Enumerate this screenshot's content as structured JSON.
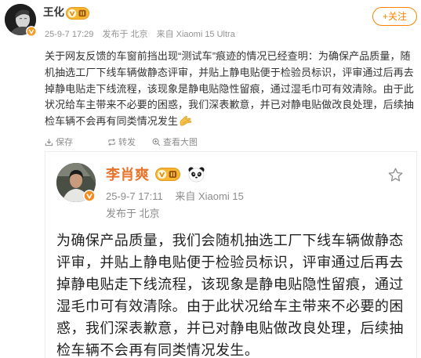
{
  "post": {
    "author": {
      "name": "王化",
      "verified_icon": "verified-badge-icon",
      "vip_icon": "vip-badge-icon"
    },
    "follow_button": {
      "label": "+关注"
    },
    "meta": {
      "time": "25-9-7 17:29",
      "location": "发布于 北京",
      "source": "来自 Xiaomi 15 Ultra"
    },
    "body_lines": [
      "关于网友反馈的车窗前挡出现“测试车”痕迹的情况已经查明：为确保产品质量，随",
      "机抽选工厂下线车辆做静态评审，并贴上静电贴便于检验员标识，评审通过后再去",
      "掉静电贴走下线流程，该现象是静电贴隐性留痕，通过湿毛巾可有效清除。由于此",
      "状况给车主带来不必要的困惑，我们深表歉意，并已对静电贴做改良处理，后续抽",
      "检车辆不会再有同类情况发生"
    ],
    "body_end_emoji_icon": "clasped-hands-emoji-icon",
    "image_actions": [
      {
        "icon": "save-icon",
        "label": "保存"
      },
      {
        "icon": "repost-icon",
        "label": "转发"
      },
      {
        "icon": "zoom-in-icon",
        "label": "查看大图"
      }
    ]
  },
  "attached_image": {
    "author": {
      "name": "李肖爽",
      "verified_icon": "verified-badge-icon",
      "vip_icon": "vip-badge-icon",
      "name_emoji_icon": "panda-emoji-icon"
    },
    "favorite_icon": "star-outline-icon",
    "time": "25-9-7 17:11",
    "source": "来自 Xiaomi 15",
    "location": "发布于 北京",
    "body_lines": [
      "为确保产品质量，我们会随机抽选工厂下线车辆做静态",
      "评审，并贴上静电贴便于检验员标识，评审通过后再去",
      "掉静电贴走下线流程，该现象是静电贴隐性留痕，通过",
      "湿毛巾可有效清除。由于此状况给车主带来不必要的困",
      "惑，我们深表歉意，并已对静电贴做改良处理，后续抽",
      "检车辆不会再有同类情况发生。"
    ]
  },
  "colors": {
    "accent": "#FF8200",
    "vip_name": "#E8742C",
    "meta_text": "#939393",
    "body_text": "#333333",
    "vip_badge": "#F7B733"
  }
}
